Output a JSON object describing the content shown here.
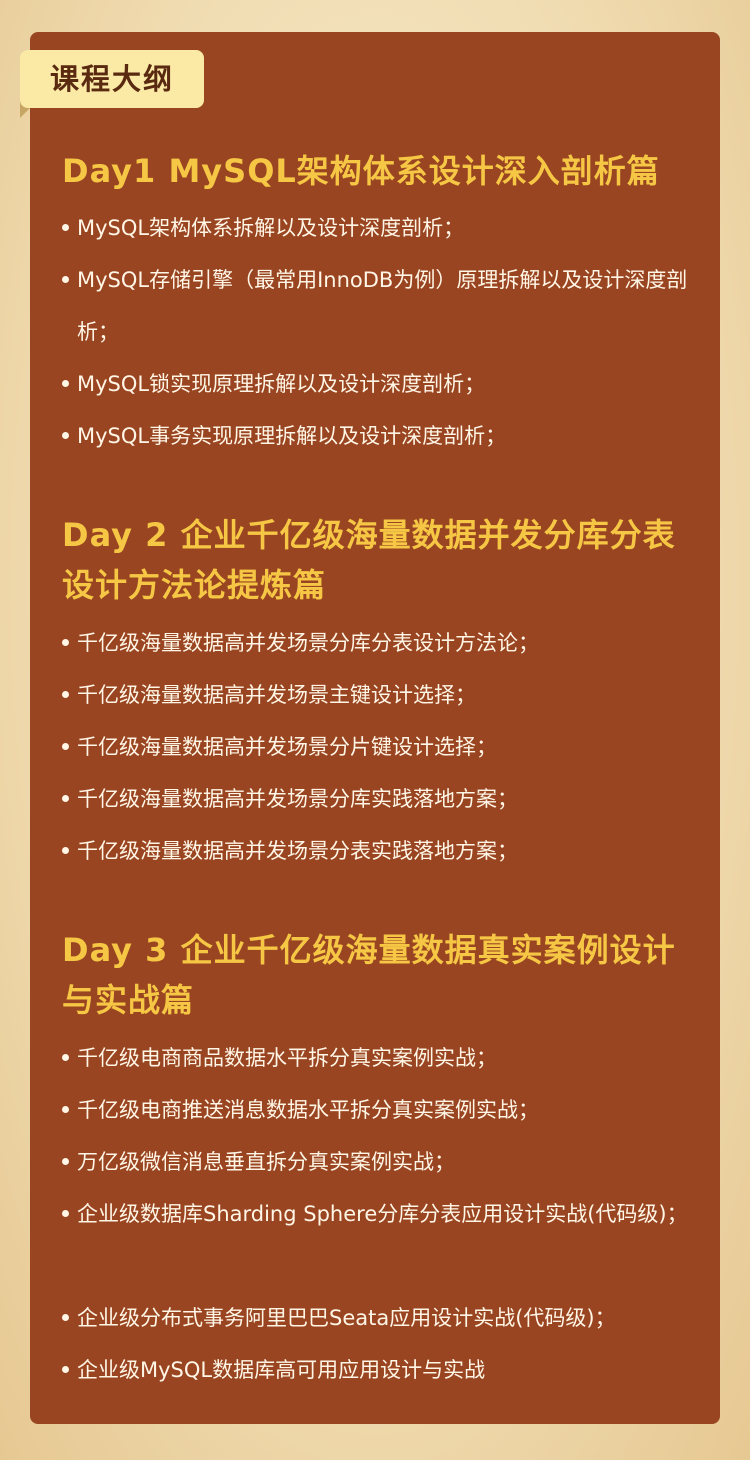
{
  "tag": {
    "label": "课程大纲"
  },
  "sections": [
    {
      "title": "Day1  MySQL架构体系设计深入剖析篇",
      "items": [
        "MySQL架构体系拆解以及设计深度剖析；",
        "MySQL存储引擎（最常用InnoDB为例）原理拆解以及设计深度剖析；",
        "MySQL锁实现原理拆解以及设计深度剖析；",
        "MySQL事务实现原理拆解以及设计深度剖析；"
      ]
    },
    {
      "title": "Day 2 企业千亿级海量数据并发分库分表设计方法论提炼篇",
      "items": [
        "千亿级海量数据高并发场景分库分表设计方法论；",
        "千亿级海量数据高并发场景主键设计选择；",
        "千亿级海量数据高并发场景分片键设计选择；",
        "千亿级海量数据高并发场景分库实践落地方案；",
        "千亿级海量数据高并发场景分表实践落地方案；"
      ]
    },
    {
      "title": "Day 3 企业千亿级海量数据真实案例设计与实战篇",
      "items": [
        "千亿级电商商品数据水平拆分真实案例实战；",
        "千亿级电商推送消息数据水平拆分真实案例实战；",
        "万亿级微信消息垂直拆分真实案例实战；",
        "企业级数据库Sharding Sphere分库分表应用设计实战(代码级)；",
        "企业级分布式事务阿里巴巴Seata应用设计实战(代码级)；",
        "企业级MySQL数据库高可用应用设计与实战"
      ]
    }
  ],
  "colors": {
    "card": "#9a4522",
    "title": "#f6c744",
    "text": "#fff6e6",
    "tag_bg": "#fbe9a6"
  }
}
